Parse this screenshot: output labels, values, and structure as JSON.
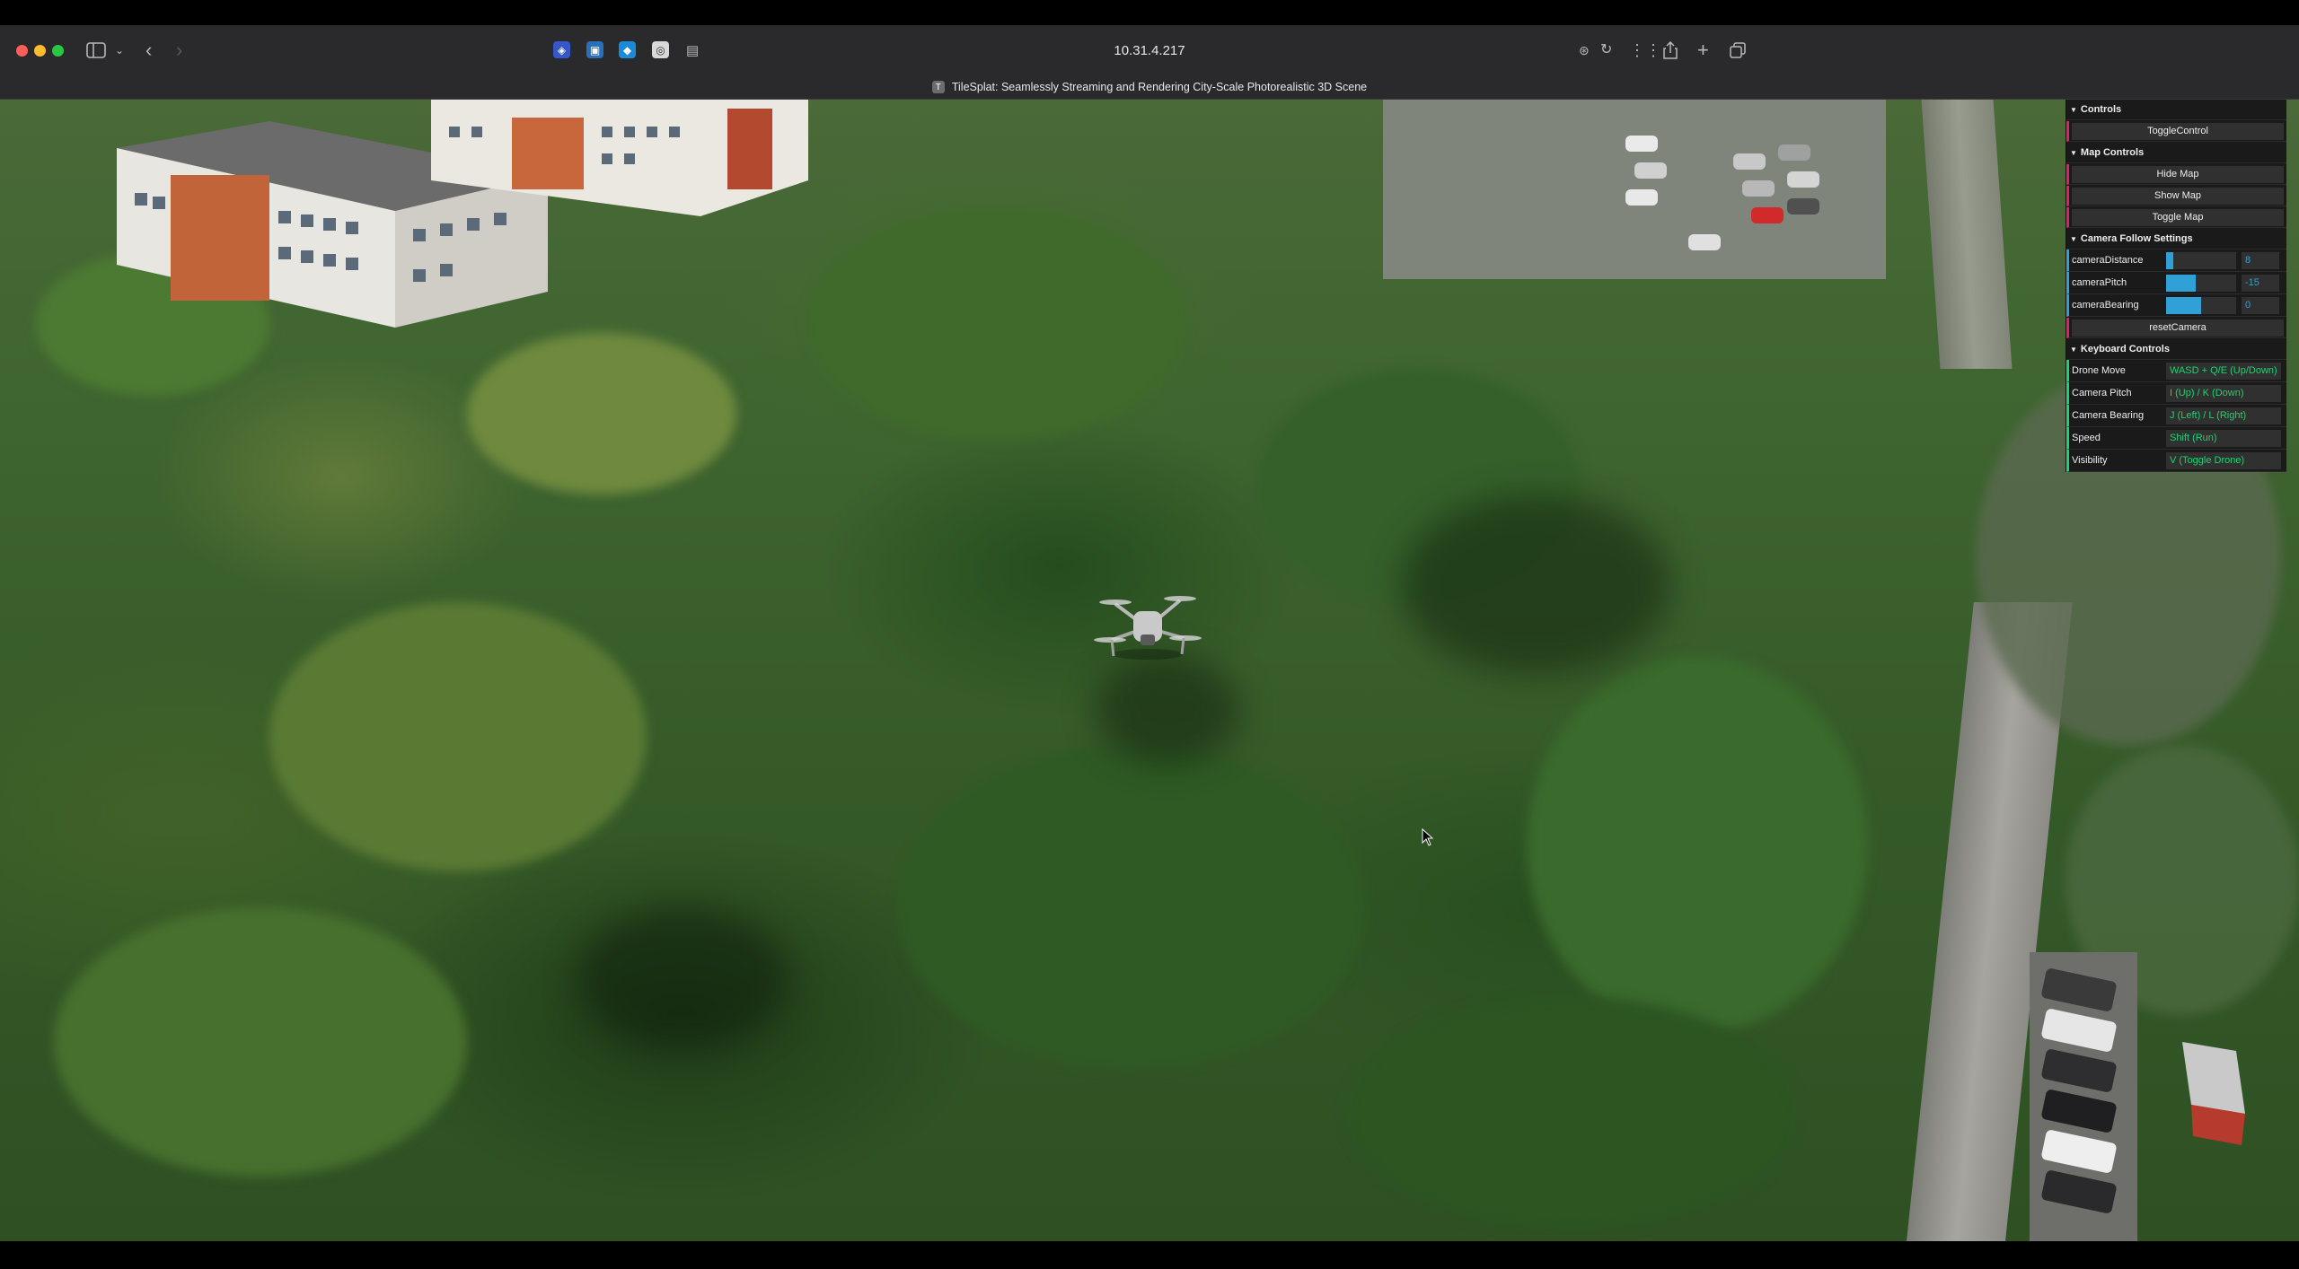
{
  "browser": {
    "address": "10.31.4.217",
    "tab_title": "TileSplat: Seamlessly Streaming and Rendering City-Scale Photorealistic 3D Scene",
    "tab_favicon_text": "T"
  },
  "panel": {
    "controls": {
      "title": "Controls",
      "toggle_label": "ToggleControl"
    },
    "map_controls": {
      "title": "Map Controls",
      "buttons": [
        "Hide Map",
        "Show Map",
        "Toggle Map"
      ]
    },
    "camera_follow": {
      "title": "Camera Follow Settings",
      "sliders": [
        {
          "label": "cameraDistance",
          "value": "8",
          "fraction": 0.1
        },
        {
          "label": "cameraPitch",
          "value": "-15",
          "fraction": 0.42
        },
        {
          "label": "cameraBearing",
          "value": "0",
          "fraction": 0.5
        }
      ],
      "reset_label": "resetCamera"
    },
    "keyboard": {
      "title": "Keyboard Controls",
      "rows": [
        {
          "label": "Drone Move",
          "value": "WASD + Q/E (Up/Down)"
        },
        {
          "label": "Camera Pitch",
          "value": "I (Up) / K (Down)"
        },
        {
          "label": "Camera Bearing",
          "value": "J (Left) / L (Right)"
        },
        {
          "label": "Speed",
          "value": "Shift (Run)"
        },
        {
          "label": "Visibility",
          "value": "V (Toggle Drone)"
        }
      ]
    }
  },
  "colors": {
    "button_accent": "#e61d5f",
    "number_accent": "#2fa1d6",
    "string_accent": "#1ed36f"
  }
}
